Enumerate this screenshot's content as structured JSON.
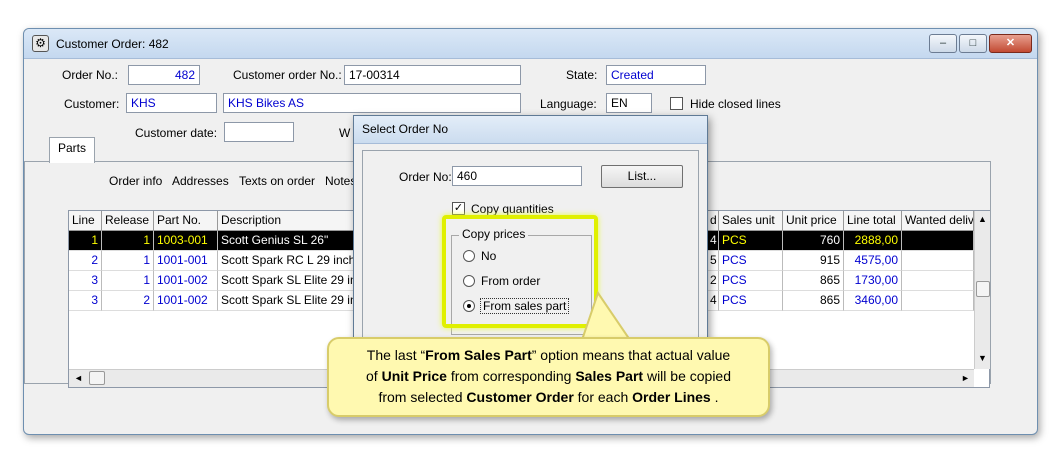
{
  "window": {
    "title": "Customer Order: 482",
    "minimize": "–",
    "maximize": "□",
    "close": "✕"
  },
  "header": {
    "order_no_label": "Order No.:",
    "order_no": "482",
    "customer_order_no_label": "Customer order No.:",
    "customer_order_no": "17-00314",
    "state_label": "State:",
    "state": "Created",
    "customer_label": "Customer:",
    "customer_code": "KHS",
    "customer_name": "KHS Bikes AS",
    "language_label": "Language:",
    "language": "EN",
    "hide_closed_label": "Hide closed lines",
    "customer_date_label": "Customer date:",
    "customer_date": "",
    "w_label": "W"
  },
  "tabs": [
    "Parts",
    "Order info",
    "Addresses",
    "Texts on order",
    "Notes"
  ],
  "grid": {
    "left_headers": [
      "Line",
      "Release",
      "Part No.",
      "Description"
    ],
    "right_headers": [
      "d",
      "Sales unit",
      "Unit price",
      "Line total",
      "Wanted deliv"
    ],
    "rows": [
      {
        "line": "1",
        "release": "1",
        "part": "1003-001",
        "desc": "Scott Genius SL 26\"",
        "qty": "4",
        "unit": "PCS",
        "price": "760",
        "total": "2888,00"
      },
      {
        "line": "2",
        "release": "1",
        "part": "1001-001",
        "desc": "Scott Spark RC L 29 inch",
        "qty": "5",
        "unit": "PCS",
        "price": "915",
        "total": "4575,00"
      },
      {
        "line": "3",
        "release": "1",
        "part": "1001-002",
        "desc": "Scott Spark SL Elite 29 in",
        "qty": "2",
        "unit": "PCS",
        "price": "865",
        "total": "1730,00"
      },
      {
        "line": "3",
        "release": "2",
        "part": "1001-002",
        "desc": "Scott Spark SL Elite 29 in",
        "qty": "4",
        "unit": "PCS",
        "price": "865",
        "total": "3460,00"
      }
    ]
  },
  "dialog": {
    "title": "Select Order No",
    "order_no_label": "Order No:",
    "order_no": "460",
    "list_button": "List...",
    "copy_quantities": "Copy quantities",
    "copy_prices_group": "Copy prices",
    "options": [
      "No",
      "From order",
      "From sales part"
    ],
    "selected": "From sales part"
  },
  "callout": {
    "p1": "The last “",
    "b1": "From Sales Part",
    "p2": "” option means that actual value",
    "p3": "of ",
    "b2": "Unit Price",
    "p4": " from corresponding ",
    "b3": "Sales Part",
    "p5": " will be copied",
    "p6": "from selected ",
    "b4": "Customer Order",
    "p7": " for each ",
    "b5": "Order Lines",
    "p8": " ."
  },
  "colors": {
    "accent_blue": "#0000d0",
    "highlight": "#e0f000",
    "callout_bg": "#fff9b0",
    "selected_row_text": "#ffff00"
  }
}
